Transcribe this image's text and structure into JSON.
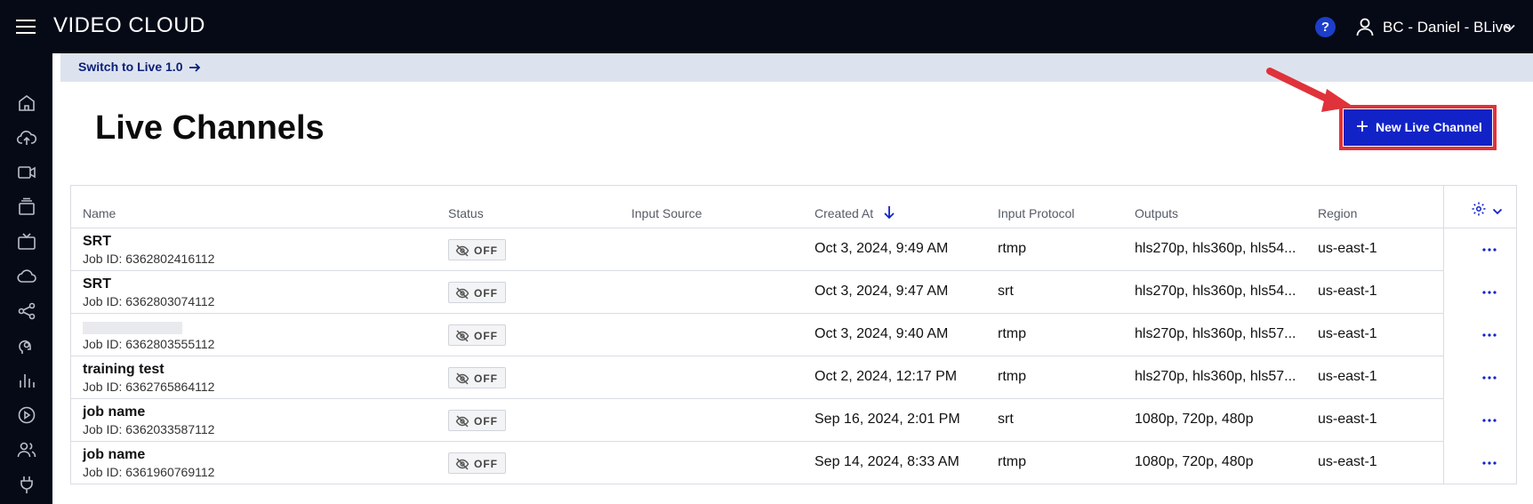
{
  "app": {
    "brand": "VIDEO CLOUD",
    "user": "BC - Daniel - BLive",
    "help_label": "?"
  },
  "banner": {
    "link_label": "Switch to Live 1.0"
  },
  "page": {
    "title": "Live Channels",
    "new_button_label": "New Live Channel"
  },
  "table": {
    "columns": [
      "Name",
      "Status",
      "Input Source",
      "Created At",
      "Input Protocol",
      "Outputs",
      "Region"
    ],
    "sort": {
      "column": "Created At",
      "direction": "descending"
    },
    "rows": [
      {
        "name": "SRT",
        "job_id": "Job ID: 6362802416112",
        "status": "OFF",
        "input_source": "",
        "created_at": "Oct 3, 2024, 9:49 AM",
        "protocol": "rtmp",
        "outputs": "hls270p, hls360p, hls54...",
        "region": "us-east-1"
      },
      {
        "name": "SRT",
        "job_id": "Job ID: 6362803074112",
        "status": "OFF",
        "input_source": "",
        "created_at": "Oct 3, 2024, 9:47 AM",
        "protocol": "srt",
        "outputs": "hls270p, hls360p, hls54...",
        "region": "us-east-1"
      },
      {
        "name": "",
        "job_id": "Job ID: 6362803555112",
        "status": "OFF",
        "input_source": "",
        "created_at": "Oct 3, 2024, 9:40 AM",
        "protocol": "rtmp",
        "outputs": "hls270p, hls360p, hls57...",
        "region": "us-east-1"
      },
      {
        "name": "training test",
        "job_id": "Job ID: 6362765864112",
        "status": "OFF",
        "input_source": "",
        "created_at": "Oct 2, 2024, 12:17 PM",
        "protocol": "rtmp",
        "outputs": "hls270p, hls360p, hls57...",
        "region": "us-east-1"
      },
      {
        "name": "job name",
        "job_id": "Job ID: 6362033587112",
        "status": "OFF",
        "input_source": "",
        "created_at": "Sep 16, 2024, 2:01 PM",
        "protocol": "srt",
        "outputs": "1080p, 720p, 480p",
        "region": "us-east-1"
      },
      {
        "name": "job name",
        "job_id": "Job ID: 6361960769112",
        "status": "OFF",
        "input_source": "",
        "created_at": "Sep 14, 2024, 8:33 AM",
        "protocol": "rtmp",
        "outputs": "1080p, 720p, 480p",
        "region": "us-east-1"
      }
    ]
  },
  "sidebar": {
    "items": [
      "home-icon",
      "upload-icon",
      "video-icon",
      "media-icon",
      "tv-icon",
      "cloud-icon",
      "share-icon",
      "audience-icon",
      "analytics-icon",
      "player-icon",
      "users-icon",
      "plugin-icon"
    ]
  },
  "colors": {
    "topbar": "#050a16",
    "accent": "#1123c7",
    "highlight": "#e0323a",
    "banner": "#dde3ee"
  }
}
